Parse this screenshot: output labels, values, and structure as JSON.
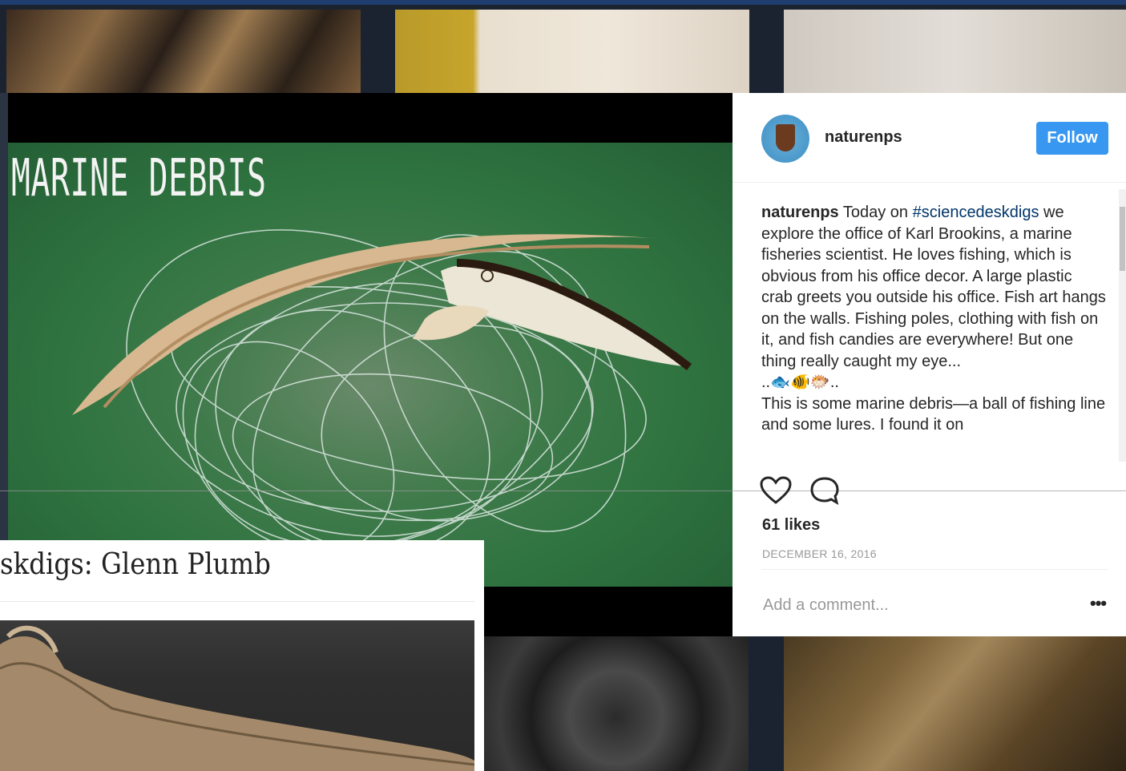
{
  "modal": {
    "photo_title": "MARINE DEBRIS",
    "username": "naturenps",
    "follow_label": "Follow",
    "caption": {
      "username": "naturenps",
      "text_before_tag": " Today on ",
      "hashtag": "#sciencedeskdigs",
      "text_after_tag": " we explore the office of Karl Brookins, a marine fisheries scientist. He loves fishing, which is obvious from his office decor. A large plastic crab greets you outside his office. Fish art hangs on the walls. Fishing poles, clothing with fish on it, and fish candies are everywhere! But one thing really caught my eye...",
      "emoji_line": "..🐟🐠🐡..",
      "text_continued": "This is some marine debris—a ball of fishing line and some lures. I found it on"
    },
    "likes": "61 likes",
    "date": "DECEMBER 16, 2016",
    "comment_placeholder": "Add a comment...",
    "more_label": "•••"
  },
  "article": {
    "title": "skdigs: Glenn Plumb"
  },
  "colors": {
    "follow_button": "#3897f0",
    "hashtag": "#003569",
    "background": "#1b2230"
  }
}
